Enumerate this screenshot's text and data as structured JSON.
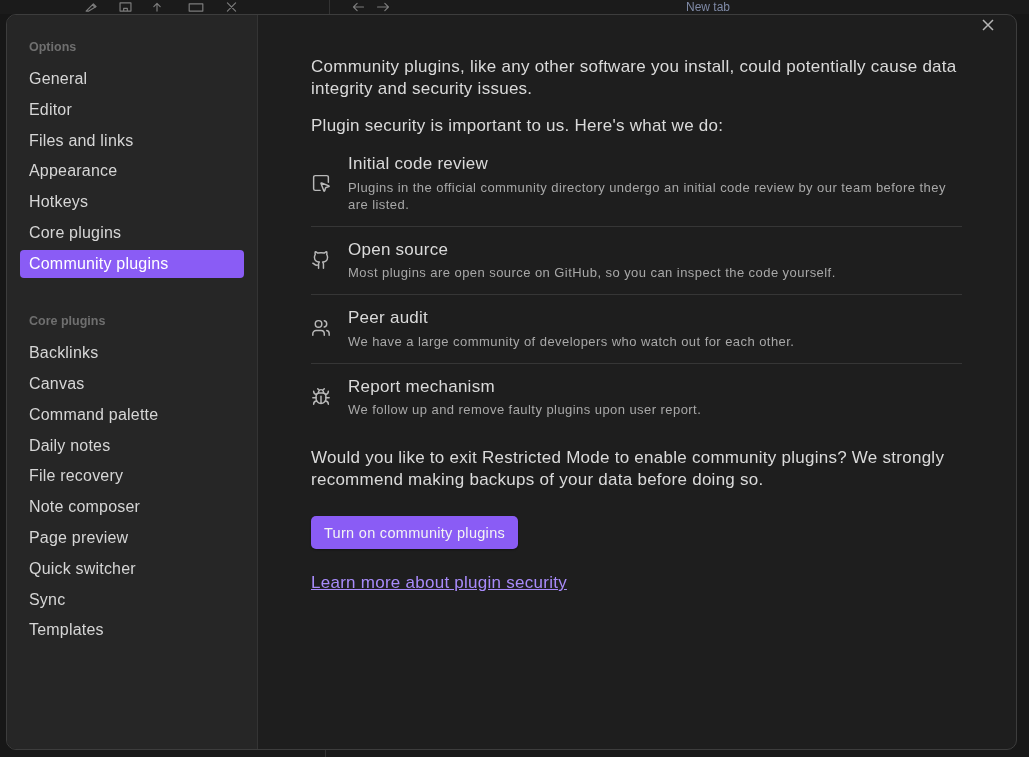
{
  "background": {
    "tab_title": "New tab"
  },
  "sidebar": {
    "sections": [
      {
        "heading": "Options",
        "items": [
          {
            "label": "General",
            "selected": false
          },
          {
            "label": "Editor",
            "selected": false
          },
          {
            "label": "Files and links",
            "selected": false
          },
          {
            "label": "Appearance",
            "selected": false
          },
          {
            "label": "Hotkeys",
            "selected": false
          },
          {
            "label": "Core plugins",
            "selected": false
          },
          {
            "label": "Community plugins",
            "selected": true
          }
        ]
      },
      {
        "heading": "Core plugins",
        "items": [
          {
            "label": "Backlinks",
            "selected": false
          },
          {
            "label": "Canvas",
            "selected": false
          },
          {
            "label": "Command palette",
            "selected": false
          },
          {
            "label": "Daily notes",
            "selected": false
          },
          {
            "label": "File recovery",
            "selected": false
          },
          {
            "label": "Note composer",
            "selected": false
          },
          {
            "label": "Page preview",
            "selected": false
          },
          {
            "label": "Quick switcher",
            "selected": false
          },
          {
            "label": "Sync",
            "selected": false
          },
          {
            "label": "Templates",
            "selected": false
          }
        ]
      }
    ]
  },
  "content": {
    "intro": "Community plugins, like any other software you install, could potentially cause data integrity and security issues.",
    "measures_heading": "Plugin security is important to us. Here's what we do:",
    "measures": [
      {
        "kind": "review",
        "title": "Initial code review",
        "description": "Plugins in the official community directory undergo an initial code review by our team before they are listed."
      },
      {
        "kind": "source",
        "title": "Open source",
        "description": "Most plugins are open source on GitHub, so you can inspect the code yourself."
      },
      {
        "kind": "audit",
        "title": "Peer audit",
        "description": "We have a large community of developers who watch out for each other."
      },
      {
        "kind": "report",
        "title": "Report mechanism",
        "description": "We follow up and remove faulty plugins upon user report."
      }
    ],
    "question": "Would you like to exit Restricted Mode to enable community plugins? We strongly recommend making backups of your data before doing so.",
    "button": "Turn on community plugins",
    "link": "Learn more about plugin security"
  }
}
